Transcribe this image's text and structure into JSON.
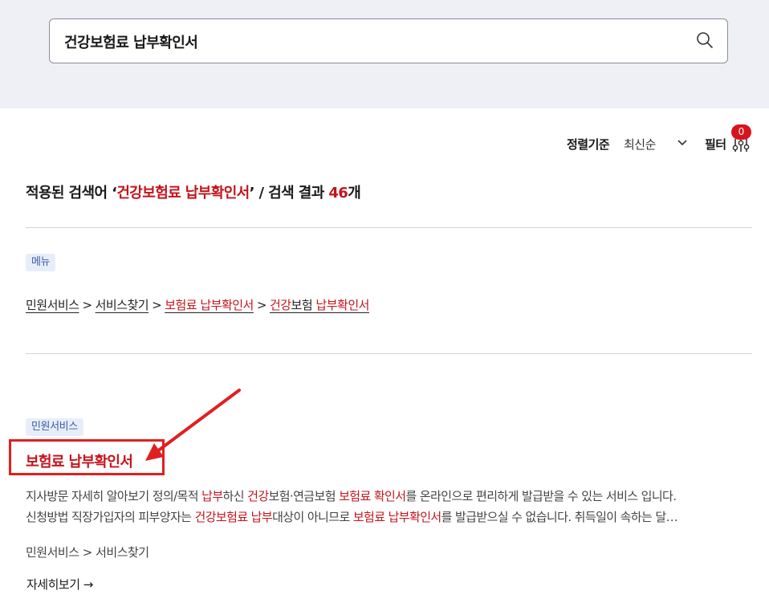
{
  "search": {
    "query": "건강보험료 납부확인서"
  },
  "sort": {
    "label": "정렬기준",
    "value": "최신순"
  },
  "filter": {
    "label": "필터",
    "count": "0"
  },
  "summary": {
    "prefix": "적용된 검색어 ‘",
    "term": "건강보험료 납부확인서",
    "middle": "’ / 검색 결과 ",
    "count": "46",
    "suffix": "개"
  },
  "menu_section": {
    "tag": "메뉴",
    "path": {
      "p1": "민원서비스",
      "sep": ">",
      "p2": "서비스찾기",
      "p3": "보험료 납부확인서",
      "p4a": "건강",
      "p4b": "보험 ",
      "p4c": "납부확인서"
    }
  },
  "result": {
    "tag": "민원서비스",
    "title": "보험료 납부확인서",
    "line1": {
      "t1": "지사방문 자세히 알아보기 정의/목적 ",
      "h1": "납부",
      "t2": "하신 ",
      "h2": "건강",
      "t3": "보험·연금보험 ",
      "h3": "보험료 확인서",
      "t4": "를 온라인으로 편리하게 발급받을 수 있는 서비스 입니다."
    },
    "line2": {
      "t1": "신청방법 직장가입자의 피부양자는 ",
      "h1": "건강보험료 납부",
      "t2": "대상이 아니므로 ",
      "h2": "보험료 납부확인서",
      "t3": "를 발급받으실 수 없습니다. 취득일이 속하는 달…"
    },
    "breadcrumb": "민원서비스 > 서비스찾기",
    "more_label": "자세히보기 →"
  }
}
